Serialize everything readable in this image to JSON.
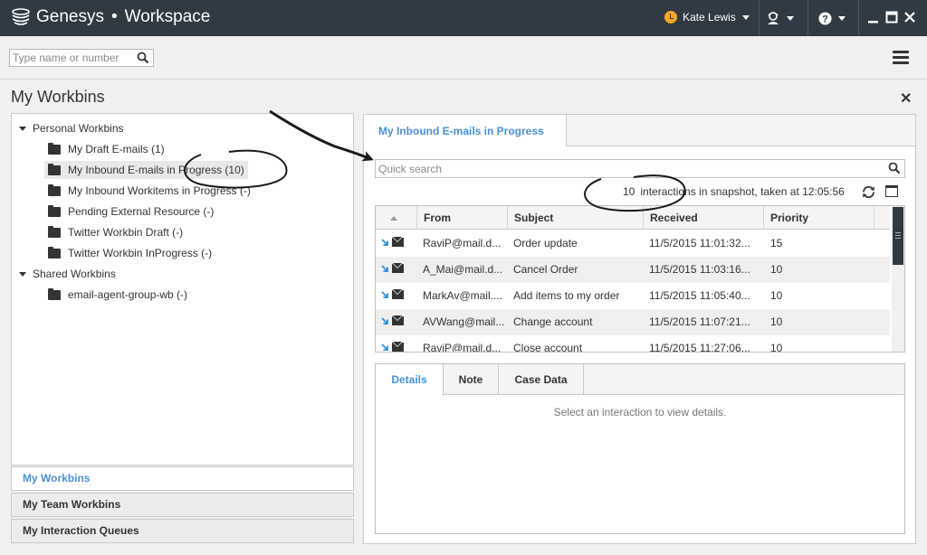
{
  "app": {
    "brand": "Genesys",
    "separator": "•",
    "product": "Workspace"
  },
  "topbar": {
    "user_name": "Kate Lewis",
    "status_color": "#f5a623"
  },
  "search": {
    "placeholder": "Type name or number"
  },
  "page": {
    "title": "My Workbins"
  },
  "tree": {
    "personal_label": "Personal Workbins",
    "personal_items": [
      "My Draft E-mails (1)",
      "My Inbound E-mails in Progress (10)",
      "My Inbound Workitems in Progress (-)",
      "Pending External Resource (-)",
      "Twitter Workbin Draft (-)",
      "Twitter Workbin InProgress (-)"
    ],
    "shared_label": "Shared Workbins",
    "shared_items": [
      "email-agent-group-wb (-)"
    ]
  },
  "leftnav": [
    "My Workbins",
    "My Team Workbins",
    "My Interaction Queues"
  ],
  "right": {
    "tab": "My Inbound E-mails in Progress",
    "quick_search_placeholder": "Quick search",
    "snapshot_count": "10",
    "snapshot_text": "interactions in snapshot, taken at 12:05:56",
    "columns": [
      "From",
      "Subject",
      "Received",
      "Priority"
    ],
    "rows": [
      {
        "from": "RaviP@mail.d...",
        "subject": "Order update",
        "received": "11/5/2015 11:01:32...",
        "priority": "15"
      },
      {
        "from": "A_Mai@mail.d...",
        "subject": "Cancel Order",
        "received": "11/5/2015 11:03:16...",
        "priority": "10"
      },
      {
        "from": "MarkAv@mail....",
        "subject": "Add items to my order",
        "received": "11/5/2015 11:05:40...",
        "priority": "10"
      },
      {
        "from": "AVWang@mail...",
        "subject": "Change account",
        "received": "11/5/2015 11:07:21...",
        "priority": "10"
      },
      {
        "from": "RaviP@mail.d...",
        "subject": "Close account",
        "received": "11/5/2015 11:27:06...",
        "priority": "10"
      }
    ],
    "detail_tabs": [
      "Details",
      "Note",
      "Case Data"
    ],
    "detail_empty": "Select an interaction to view details."
  },
  "colors": {
    "accent": "#4a90d9",
    "titlebar": "#2f3a42",
    "status": "#f5a623",
    "arrow": "#1a1a1a"
  },
  "icons": [
    "genesys-logo-icon",
    "status-available-icon",
    "agent-status-icon",
    "help-icon",
    "minimize-icon",
    "maximize-icon",
    "close-icon",
    "search-icon",
    "menu-icon",
    "folder-icon",
    "expand-triangle-icon",
    "refresh-icon",
    "maximize-panel-icon",
    "email-icon",
    "inbound-arrow-icon"
  ]
}
